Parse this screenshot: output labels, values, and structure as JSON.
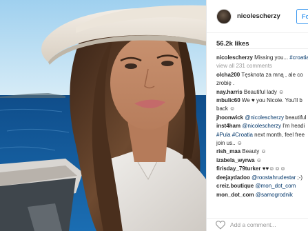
{
  "post": {
    "username": "nicolescherzy",
    "follow_label": "Follow",
    "likes": "56.2k likes",
    "view_all": "view all 231 comments",
    "add_comment_placeholder": "Add a comment...",
    "comments": [
      {
        "user": "nicolescherzy",
        "text": "Missing you... ",
        "tag": "#croatia"
      },
      {
        "user": "olcha200",
        "text": "Tęsknota za mną , ale co",
        "line2": "zrobię ."
      },
      {
        "user": "nay.harris",
        "text": "Beautiful lady ☺"
      },
      {
        "user": "mbulic60",
        "text": "We ♥ you Nicole. You'll b",
        "line2": "back ☺"
      },
      {
        "user": "jhoonwick",
        "mention": "@nicolescherzy",
        "text": " beautiful"
      },
      {
        "user": "inst4ham",
        "mention": "@nicolescherzy",
        "text": " I'm headi",
        "tag2": "#Pula",
        "tag3": "#Croatia",
        "line2": " next month, feel free",
        "line3": "join us.. ☺"
      },
      {
        "user": "rish_maa",
        "text": "Beauty ☺"
      },
      {
        "user": "izabela_wyrwa",
        "text": "☺"
      },
      {
        "user": "firisday_79turker",
        "text": "♥♥☺☺☺"
      },
      {
        "user": "deejaydadoo",
        "mention": "@roostahrudestar",
        "text": " ;-)"
      },
      {
        "user": "creiz.boutique",
        "mention": "@mon_dot_com"
      },
      {
        "user": "mon_dot_com",
        "mention": "@samogrodnik"
      }
    ]
  },
  "colors": {
    "link": "#003569",
    "follow": "#3897f0",
    "muted": "#999999",
    "text": "#262626"
  }
}
